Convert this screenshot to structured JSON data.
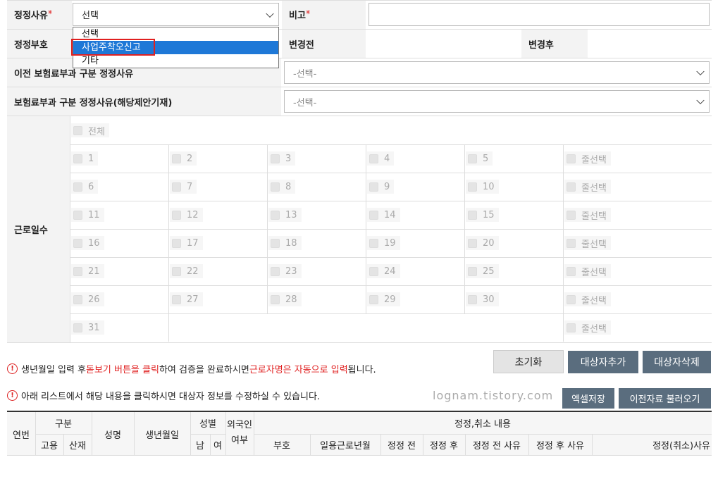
{
  "form": {
    "correction_reason_label": "정정사유",
    "required_mark": "*",
    "correction_reason_value": "선택",
    "remark_label": "비고",
    "correction_code_label": "정정부호",
    "before_label": "변경전",
    "after_label": "변경후",
    "prev_insurance_label": "이전 보험료부과 구분 정정사유",
    "prev_insurance_value": "-선택-",
    "insurance_label": "보험료부과 구분 정정사유(해당제안기재)",
    "insurance_value": "-선택-",
    "workdays_label": "근로일수",
    "all_label": "전체",
    "row_select_label": "줄선택",
    "days": [
      "1",
      "2",
      "3",
      "4",
      "5",
      "6",
      "7",
      "8",
      "9",
      "10",
      "11",
      "12",
      "13",
      "14",
      "15",
      "16",
      "17",
      "18",
      "19",
      "20",
      "21",
      "22",
      "23",
      "24",
      "25",
      "26",
      "27",
      "28",
      "29",
      "30",
      "31"
    ]
  },
  "dropdown": {
    "options": [
      "선택",
      "사업주착오신고",
      "기타"
    ],
    "selected_index": 1
  },
  "notices": {
    "notice1_a": "생년월일 입력 후 ",
    "notice1_b": "돋보기 버튼을 클릭",
    "notice1_c": "하여 검증을 완료하시면 ",
    "notice1_d": "근로자명은 자동으로 입력",
    "notice1_e": "됩니다.",
    "notice2": "아래 리스트에서 해당 내용을 클릭하시면 대상자 정보를 수정하실 수 있습니다.",
    "icon_glyph": "!"
  },
  "buttons": {
    "reset": "초기화",
    "add_target": "대상자추가",
    "delete_target": "대상자삭제",
    "excel_save": "엑셀저장",
    "load_previous": "이전자료 불러오기"
  },
  "watermark": "lognam.tistory.com",
  "table": {
    "no": "연번",
    "category": "구분",
    "employment": "고용",
    "industrial": "산재",
    "name": "성명",
    "birth": "생년월일",
    "gender": "성별",
    "male": "남",
    "female": "여",
    "foreigner_1": "외국인",
    "foreigner_2": "여부",
    "correction_content": "정정,취소 내용",
    "code": "부호",
    "work_month": "일용근로년월",
    "before": "정정 전",
    "after": "정정 후",
    "before_reason": "정정 전 사유",
    "after_reason": "정정 후 사유",
    "cancel_reason": "정정(취소)사유"
  },
  "colors": {
    "required": "#e02020",
    "highlight": "#e02020",
    "dropdown_selected": "#1e78d7",
    "slate_button": "#5a6d7e"
  }
}
